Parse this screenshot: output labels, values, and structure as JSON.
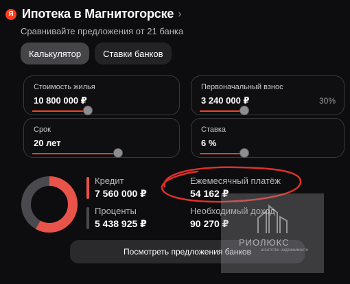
{
  "header": {
    "logo": "Я",
    "title": "Ипотека в Магнитогорске",
    "chevron": "›",
    "subtitle": "Сравнивайте предложения от 21 банка"
  },
  "tabs": [
    {
      "label": "Калькулятор",
      "active": true
    },
    {
      "label": "Ставки банков",
      "active": false
    }
  ],
  "fields": {
    "price": {
      "label": "Стоимость жилья",
      "value": "10 800 000 ₽",
      "slider_fraction": 0.4
    },
    "down_payment": {
      "label": "Первоначальный взнос",
      "value": "3 240 000 ₽",
      "percent": "30%",
      "slider_fraction": 0.3
    },
    "term": {
      "label": "Срок",
      "value": "20 лет",
      "slider_fraction": 0.55
    },
    "rate": {
      "label": "Ставка",
      "value": "6 %",
      "slider_fraction": 0.3
    }
  },
  "summary": {
    "credit": {
      "label": "Кредит",
      "value": "7 560 000 ₽"
    },
    "interest": {
      "label": "Проценты",
      "value": "5 438 925 ₽"
    },
    "monthly": {
      "label": "Ежемесячный платёж",
      "value": "54 162 ₽"
    },
    "income": {
      "label": "Необходимый доход",
      "value": "90 270 ₽"
    }
  },
  "donut": {
    "credit_share": 0.58,
    "credit_color": "#e8534a",
    "interest_color": "#4a4a4e"
  },
  "cta": {
    "label": "Посмотреть предложения банков"
  },
  "watermark": {
    "brand": "РИОЛЮКС",
    "tagline": "агентство недвижимости"
  },
  "colors": {
    "accent": "#fc3f1d",
    "background": "#0d0d0f",
    "annotation": "#e0302a"
  }
}
